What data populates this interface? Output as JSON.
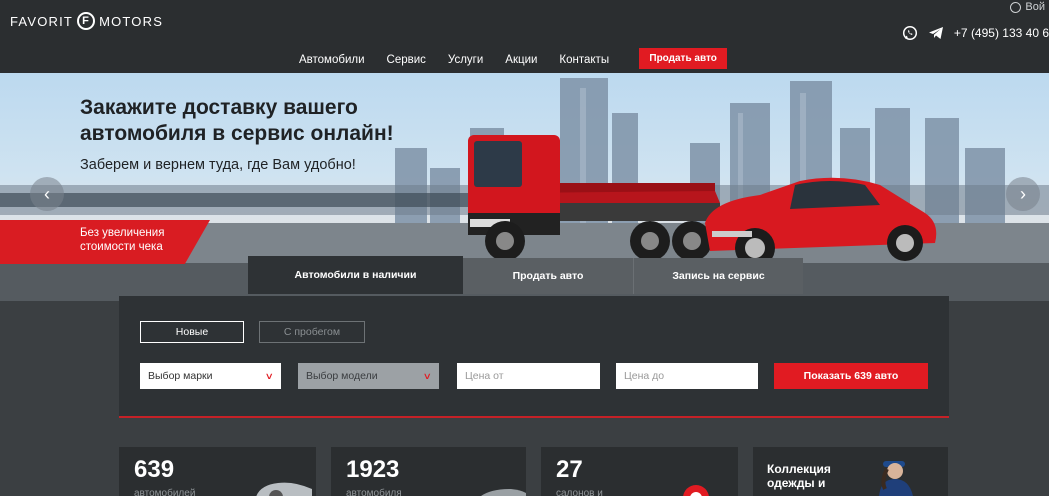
{
  "header": {
    "logo_left": "FAVORIT",
    "logo_badge": "F",
    "logo_right": "MOTORS",
    "login": "Вой",
    "phone": "+7 (495) 133 40 6",
    "nav": [
      "Автомобили",
      "Сервис",
      "Услуги",
      "Акции",
      "Контакты"
    ],
    "sell_button": "Продать авто"
  },
  "hero": {
    "title": "Закажите доставку вашего автомобиля в сервис онлайн!",
    "subtitle": "Заберем и вернем туда, где Вам удобно!",
    "promo": "Без увеличения стоимости чека"
  },
  "search": {
    "tabs": [
      "Автомобили в наличии",
      "Продать авто",
      "Запись на сервис"
    ],
    "segments": [
      "Новые",
      "С пробегом"
    ],
    "brand_select": "Выбор марки",
    "model_select": "Выбор модели",
    "price_from": "Цена от",
    "price_to": "Цена до",
    "submit": "Показать 639 авто"
  },
  "stats": [
    {
      "number": "639",
      "caption": "автомобилей"
    },
    {
      "number": "1923",
      "caption": "автомобиля"
    },
    {
      "number": "27",
      "caption": "салонов и"
    }
  ],
  "merch": {
    "title": "Коллекция одежды и"
  },
  "colors": {
    "accent": "#e11b22",
    "header_bg": "#2b2e30",
    "panel_bg": "#2e3235",
    "page_bg": "#3b3f42"
  }
}
